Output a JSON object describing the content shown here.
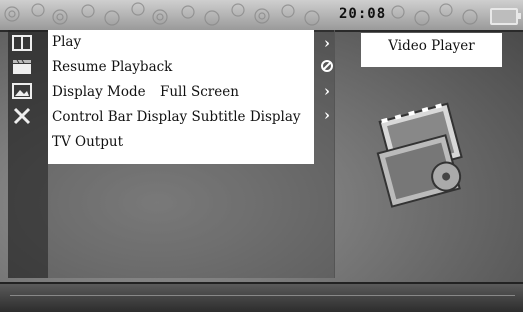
{
  "status": {
    "clock": "20:08",
    "battery": "battery-icon"
  },
  "menu": {
    "items": [
      {
        "label": "Play",
        "value": ""
      },
      {
        "label": "Resume Playback",
        "value": ""
      },
      {
        "label": "Display Mode",
        "value": "Full Screen"
      },
      {
        "label": "Control Bar Display",
        "value": "Subtitle Display"
      },
      {
        "label": "TV Output",
        "value": ""
      }
    ]
  },
  "title": "Video Player",
  "icons": [
    "book-icon",
    "film-clap-icon",
    "image-icon",
    "tools-icon"
  ],
  "indicators": [
    "chevron-right",
    "no-entry",
    "chevron-right",
    "chevron-right"
  ]
}
